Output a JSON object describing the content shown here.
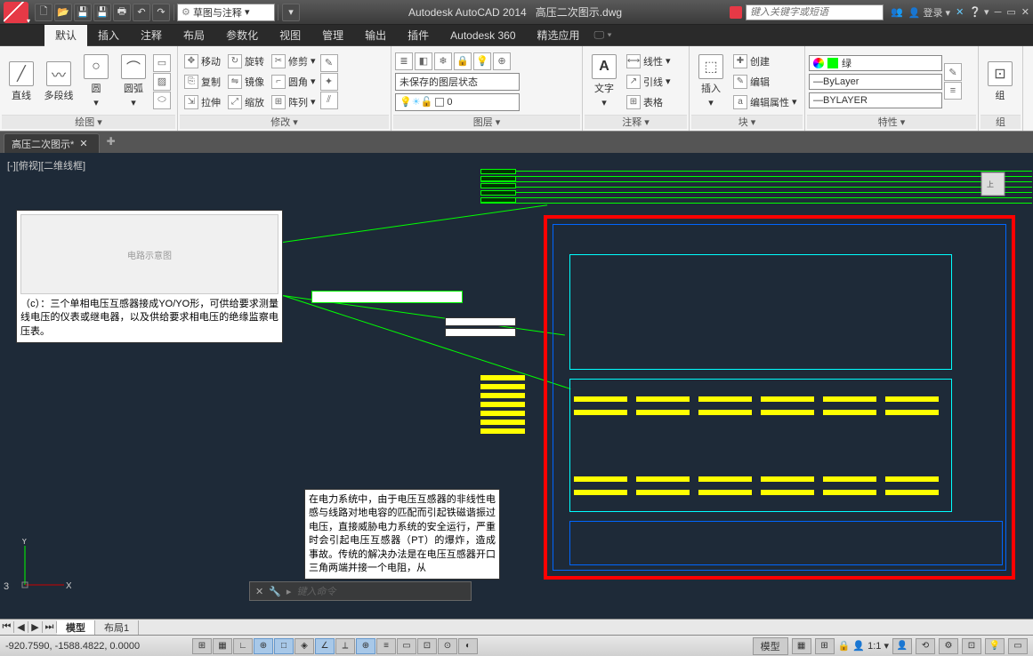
{
  "titlebar": {
    "workspace": "草图与注释",
    "app": "Autodesk AutoCAD 2014",
    "filename": "高压二次图示.dwg",
    "search_placeholder": "键入关键字或短语",
    "login": "登录"
  },
  "menu": {
    "tabs": [
      "默认",
      "插入",
      "注释",
      "布局",
      "参数化",
      "视图",
      "管理",
      "输出",
      "插件",
      "Autodesk 360",
      "精选应用"
    ]
  },
  "ribbon": {
    "draw": {
      "title": "绘图 ▾",
      "line": "直线",
      "polyline": "多段线",
      "circle": "圆",
      "arc": "圆弧"
    },
    "modify": {
      "title": "修改 ▾",
      "move": "移动",
      "rotate": "旋转",
      "trim": "修剪",
      "copy": "复制",
      "mirror": "镜像",
      "fillet": "圆角",
      "stretch": "拉伸",
      "scale": "缩放",
      "array": "阵列"
    },
    "layers": {
      "title": "图层 ▾",
      "state": "未保存的图层状态",
      "current": "0"
    },
    "annotation": {
      "title": "注释 ▾",
      "text": "文字",
      "linear": "线性",
      "leader": "引线",
      "table": "表格"
    },
    "block": {
      "title": "块 ▾",
      "insert": "插入",
      "create": "创建",
      "edit": "编辑",
      "edit_attr": "编辑属性"
    },
    "properties": {
      "title": "特性 ▾",
      "color": "绿",
      "linetype": "ByLayer",
      "lineweight": "BYLAYER"
    },
    "group": {
      "title": "组",
      "label": "组"
    }
  },
  "filetabs": {
    "tab1": "高压二次图示*"
  },
  "drawing": {
    "view_label": "[-][俯视][二维线框]",
    "callout1_text": "（c）：三个单相电压互感器接成YO/YO形，可供给要求测量线电压的仪表或继电器，以及供给要求相电压的绝缘监察电压表。",
    "callout1_img": "电路示意图",
    "callout2_text": "在电力系统中，由于电压互感器的非线性电感与线路对地电容的匹配而引起铁磁谐振过电压，直接威胁电力系统的安全运行，严重时会引起电压互感器（PT）的爆炸，造成事故。传统的解决办法是在电压互感器开口三角两端并接一个电阻，从"
  },
  "layout": {
    "model": "模型",
    "layout1": "布局1"
  },
  "cmdline": {
    "hint": "键入命令"
  },
  "status": {
    "coords": "-920.7590, -1588.4822, 0.0000",
    "space": "模型",
    "scale": "1:1"
  }
}
